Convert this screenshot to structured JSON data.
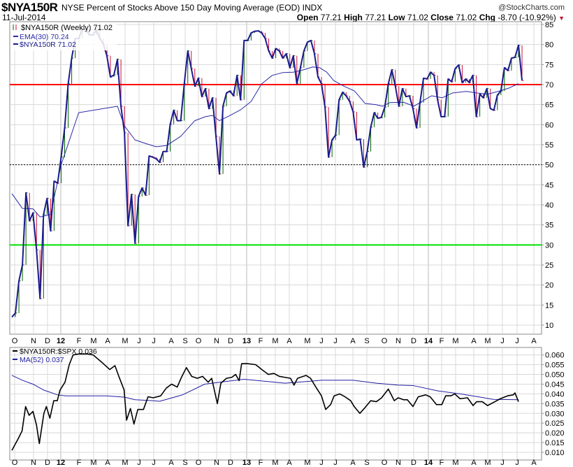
{
  "header": {
    "symbol": "$NYA150R",
    "description": "NYSE Percent of Stocks Above 150 Day Moving Average (EOD) INDX",
    "date": "11-Jul-2014",
    "brand": "@StockCharts.com",
    "open_label": "Open",
    "open": "77.21",
    "high_label": "High",
    "high": "77.21",
    "low_label": "Low",
    "low": "71.02",
    "close_label": "Close",
    "close": "71.02",
    "chg_label": "Chg",
    "chg": "-8.70 (-10.92%)",
    "chg_icon": "down-triangle-icon"
  },
  "colors": {
    "up": "#006400",
    "down": "#d0103a",
    "price": "#1a1a8c",
    "ema": "#2a2aa8",
    "red_line": "#ff0000",
    "green_line": "#00e000",
    "ratio": "#000000",
    "ma": "#2020a0",
    "grid": "#d8d8d8"
  },
  "chart_data": [
    {
      "type": "line",
      "title": "$NYA150R NYSE Percent of Stocks Above 150 Day Moving Average (EOD) INDX",
      "legend": [
        "$NYA150R (Weekly) 71.02",
        "EMA(30) 70.24",
        "$NYA150R 71.02"
      ],
      "legend_position": "top-left",
      "ylim": [
        8,
        86
      ],
      "yticks": [
        10,
        15,
        20,
        25,
        30,
        35,
        40,
        45,
        50,
        55,
        60,
        65,
        70,
        75,
        80,
        85
      ],
      "xtick_labels": [
        "O",
        "N",
        "D",
        "12",
        "F",
        "M",
        "A",
        "M",
        "J",
        "J",
        "A",
        "S",
        "O",
        "N",
        "D",
        "13",
        "F",
        "M",
        "A",
        "M",
        "J",
        "J",
        "A",
        "S",
        "O",
        "N",
        "D",
        "14",
        "F",
        "M",
        "A",
        "M",
        "J",
        "J",
        "A"
      ],
      "grid": true,
      "x_unit": "weeks since Oct 2011",
      "close": [
        12,
        13,
        21,
        25,
        43,
        36,
        38,
        28.8,
        16.6,
        37.6,
        41.6,
        33.5,
        45.9,
        45.4,
        51.9,
        59.2,
        70.2,
        76.6,
        81.5,
        81.5,
        83.8,
        83.8,
        82.4,
        82.4,
        83.6,
        81.5,
        80.1,
        77.2,
        71.9,
        72.4,
        76.3,
        64.6,
        58,
        34.8,
        42.6,
        30.4,
        42.1,
        44.2,
        42.4,
        52.2,
        51.9,
        51.5,
        50.6,
        53.3,
        53.3,
        60.1,
        63.6,
        61,
        61,
        70.2,
        78.4,
        74,
        69.6,
        71.6,
        67,
        69,
        64,
        66.7,
        57.1,
        47.7,
        64.6,
        67.9,
        68.4,
        67.2,
        72.3,
        66.2,
        81,
        81,
        82.9,
        83.3,
        83.4,
        82.9,
        81.5,
        78.4,
        76.6,
        79,
        78.4,
        76.6,
        77.7,
        74.2,
        77.2,
        70.2,
        74.2,
        78.4,
        80.6,
        81,
        77.7,
        71.9,
        70.2,
        64.4,
        51.9,
        56.2,
        57.4,
        66.2,
        68.1,
        67.2,
        65.8,
        63.2,
        56.2,
        56.4,
        49.4,
        53.3,
        59.4,
        63,
        61.6,
        61.8,
        64.4,
        70.2,
        73.7,
        69.6,
        64.6,
        69,
        67,
        67.2,
        64,
        59.2,
        65.5,
        71.6,
        71.4,
        73.1,
        72.3,
        66.2,
        62,
        62,
        71.4,
        70.7,
        74,
        74.9,
        70.5,
        71.4,
        70.5,
        72.3,
        62,
        67.6,
        66.7,
        69,
        64,
        63.6,
        67.4,
        68.4,
        74.2,
        73.5,
        76.6,
        76.8,
        79.8,
        71.02
      ],
      "ema30": [
        [
          0,
          42.8
        ],
        [
          3,
          39.1
        ],
        [
          6,
          39
        ],
        [
          8,
          37
        ],
        [
          11,
          37.6
        ],
        [
          14,
          50
        ],
        [
          19,
          63
        ],
        [
          30,
          64.6
        ],
        [
          32,
          59.7
        ],
        [
          35,
          56.2
        ],
        [
          38,
          55.3
        ],
        [
          41,
          54.5
        ],
        [
          44,
          54.8
        ],
        [
          48,
          57.1
        ],
        [
          52,
          61
        ],
        [
          55,
          62
        ],
        [
          57,
          62.3
        ],
        [
          59,
          61
        ],
        [
          62,
          62.3
        ],
        [
          65,
          63.7
        ],
        [
          68,
          65.8
        ],
        [
          71,
          70.2
        ],
        [
          74,
          72.3
        ],
        [
          77,
          73
        ],
        [
          80,
          73.1
        ],
        [
          83,
          73.7
        ],
        [
          85.5,
          74.4
        ],
        [
          87.5,
          74.2
        ],
        [
          89.5,
          73.1
        ],
        [
          91.5,
          71
        ],
        [
          94.4,
          69.6
        ],
        [
          97.4,
          68.4
        ],
        [
          100.4,
          65.3
        ],
        [
          103.4,
          65
        ],
        [
          105.4,
          64.6
        ],
        [
          107.4,
          65.5
        ],
        [
          111.3,
          65.6
        ],
        [
          114.3,
          64.6
        ],
        [
          117.3,
          66.2
        ],
        [
          119.3,
          67.2
        ],
        [
          122.3,
          66.7
        ],
        [
          125.2,
          67.9
        ],
        [
          129.2,
          68.3
        ],
        [
          132.2,
          67.9
        ],
        [
          135.2,
          67.6
        ],
        [
          138.2,
          68.3
        ],
        [
          141.2,
          69.1
        ],
        [
          144,
          70.24
        ]
      ],
      "reference_lines": [
        {
          "value": 70,
          "color": "red",
          "style": "solid"
        },
        {
          "value": 50,
          "color": "black",
          "style": "dotted"
        },
        {
          "value": 30,
          "color": "green",
          "style": "solid"
        }
      ]
    },
    {
      "type": "line",
      "legend": [
        "$NYA150R:$SPX 0.036",
        "MA(52) 0.037"
      ],
      "legend_position": "top-left",
      "ylim": [
        0.0085,
        0.0612
      ],
      "yticks": [
        "0.010",
        "0.015",
        "0.020",
        "0.025",
        "0.030",
        "0.035",
        "0.040",
        "0.045",
        "0.050",
        "0.055",
        "0.060"
      ],
      "xtick_labels": [
        "O",
        "N",
        "D",
        "12",
        "F",
        "M",
        "A",
        "M",
        "J",
        "J",
        "A",
        "S",
        "O",
        "N",
        "D",
        "13",
        "F",
        "M",
        "A",
        "M",
        "J",
        "J",
        "A",
        "S",
        "O",
        "N",
        "D",
        "14",
        "F",
        "M",
        "A",
        "M",
        "J",
        "J",
        "A"
      ],
      "grid": true,
      "ratio": [
        [
          0,
          0.011
        ],
        [
          1.8,
          0.017
        ],
        [
          2.9,
          0.021
        ],
        [
          3.9,
          0.0335
        ],
        [
          4.9,
          0.029
        ],
        [
          6,
          0.031
        ],
        [
          7,
          0.024
        ],
        [
          7.8,
          0.0145
        ],
        [
          9.1,
          0.03
        ],
        [
          9.8,
          0.0335
        ],
        [
          10.8,
          0.0275
        ],
        [
          11.9,
          0.0365
        ],
        [
          12.9,
          0.0365
        ],
        [
          13.7,
          0.042
        ],
        [
          15.1,
          0.046
        ],
        [
          16.3,
          0.055
        ],
        [
          17.4,
          0.06
        ],
        [
          19,
          0.0605
        ],
        [
          21.5,
          0.0605
        ],
        [
          23.1,
          0.06
        ],
        [
          25.7,
          0.056
        ],
        [
          27.8,
          0.0525
        ],
        [
          29.3,
          0.0545
        ],
        [
          30.4,
          0.049
        ],
        [
          31.9,
          0.042
        ],
        [
          32.6,
          0.0265
        ],
        [
          33.7,
          0.0325
        ],
        [
          34.7,
          0.0245
        ],
        [
          35.8,
          0.032
        ],
        [
          37.4,
          0.032
        ],
        [
          38.7,
          0.0385
        ],
        [
          40.2,
          0.038
        ],
        [
          42.3,
          0.039
        ],
        [
          43.9,
          0.043
        ],
        [
          45.4,
          0.045
        ],
        [
          47,
          0.0435
        ],
        [
          48.2,
          0.0485
        ],
        [
          49.6,
          0.0535
        ],
        [
          51.1,
          0.049
        ],
        [
          52.7,
          0.048
        ],
        [
          54.2,
          0.049
        ],
        [
          55.8,
          0.046
        ],
        [
          56.8,
          0.048
        ],
        [
          58.4,
          0.035
        ],
        [
          59.4,
          0.0455
        ],
        [
          61,
          0.048
        ],
        [
          62.5,
          0.0485
        ],
        [
          63.6,
          0.05
        ],
        [
          64.6,
          0.0468
        ],
        [
          65.3,
          0.0555
        ],
        [
          67.2,
          0.0555
        ],
        [
          69.3,
          0.055
        ],
        [
          71.4,
          0.052
        ],
        [
          72.9,
          0.05
        ],
        [
          74.5,
          0.0505
        ],
        [
          76,
          0.049
        ],
        [
          77.6,
          0.0485
        ],
        [
          79.2,
          0.048
        ],
        [
          80.2,
          0.0445
        ],
        [
          81.2,
          0.048
        ],
        [
          83.6,
          0.0495
        ],
        [
          84.9,
          0.048
        ],
        [
          86.4,
          0.0435
        ],
        [
          88,
          0.039
        ],
        [
          89.2,
          0.032
        ],
        [
          90.6,
          0.0345
        ],
        [
          91.6,
          0.039
        ],
        [
          93.2,
          0.04
        ],
        [
          94.7,
          0.0385
        ],
        [
          96.3,
          0.0365
        ],
        [
          97.3,
          0.0335
        ],
        [
          98.9,
          0.03
        ],
        [
          100.4,
          0.033
        ],
        [
          102,
          0.0365
        ],
        [
          103.6,
          0.036
        ],
        [
          105.1,
          0.038
        ],
        [
          107,
          0.0425
        ],
        [
          108.7,
          0.0365
        ],
        [
          109.8,
          0.038
        ],
        [
          111.3,
          0.037
        ],
        [
          112.4,
          0.037
        ],
        [
          114,
          0.0335
        ],
        [
          115.5,
          0.0385
        ],
        [
          117.6,
          0.0395
        ],
        [
          118.9,
          0.0385
        ],
        [
          120.7,
          0.0345
        ],
        [
          122.2,
          0.0345
        ],
        [
          123.3,
          0.039
        ],
        [
          124.8,
          0.039
        ],
        [
          125.9,
          0.04
        ],
        [
          127.4,
          0.0375
        ],
        [
          129.5,
          0.038
        ],
        [
          131.1,
          0.034
        ],
        [
          132.1,
          0.036
        ],
        [
          133.7,
          0.036
        ],
        [
          135.2,
          0.034
        ],
        [
          137.3,
          0.036
        ],
        [
          138.8,
          0.0375
        ],
        [
          140.9,
          0.039
        ],
        [
          142.5,
          0.0395
        ],
        [
          143,
          0.0405
        ],
        [
          144,
          0.036
        ]
      ],
      "ma52": [
        [
          0,
          0.0495
        ],
        [
          3,
          0.047
        ],
        [
          6,
          0.045
        ],
        [
          9,
          0.042
        ],
        [
          13,
          0.0395
        ],
        [
          15.3,
          0.039
        ],
        [
          27,
          0.039
        ],
        [
          32,
          0.0383
        ],
        [
          35,
          0.037
        ],
        [
          40,
          0.0365
        ],
        [
          42,
          0.0362
        ],
        [
          48.5,
          0.0395
        ],
        [
          54.8,
          0.045
        ],
        [
          59,
          0.046
        ],
        [
          66,
          0.0475
        ],
        [
          77.6,
          0.0455
        ],
        [
          85,
          0.0465
        ],
        [
          88,
          0.047
        ],
        [
          97,
          0.047
        ],
        [
          103.6,
          0.0455
        ],
        [
          109.8,
          0.0445
        ],
        [
          114,
          0.0443
        ],
        [
          121.2,
          0.0415
        ],
        [
          127.4,
          0.04
        ],
        [
          132.6,
          0.0385
        ],
        [
          136.8,
          0.0372
        ],
        [
          144,
          0.037
        ]
      ]
    }
  ]
}
